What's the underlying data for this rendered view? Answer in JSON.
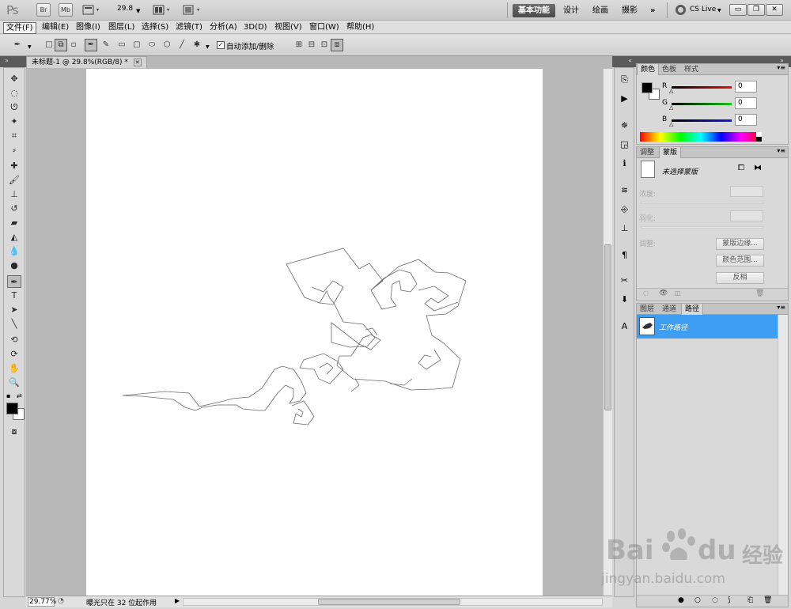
{
  "titlebar": {
    "logo": "Ps",
    "bridge_label": "Br",
    "minibridge_label": "Mb",
    "zoom": "29.8",
    "workspaces": [
      "基本功能",
      "设计",
      "绘画",
      "摄影"
    ],
    "more": "»",
    "cs_live": "CS Live"
  },
  "menu": [
    "文件(F)",
    "编辑(E)",
    "图像(I)",
    "图层(L)",
    "选择(S)",
    "滤镜(T)",
    "分析(A)",
    "3D(D)",
    "视图(V)",
    "窗口(W)",
    "帮助(H)"
  ],
  "options": {
    "auto_add_delete": "自动添加/删除",
    "auto_checked": "✓"
  },
  "document": {
    "tab_title": "未标题-1 @ 29.8%(RGB/8) *",
    "close": "✕"
  },
  "status": {
    "zoom": "29.77%",
    "message": "曝光只在 32 位起作用"
  },
  "color_panel": {
    "tabs": [
      "颜色",
      "色板",
      "样式"
    ],
    "channels": [
      {
        "label": "R",
        "value": "0",
        "color": "#d01010"
      },
      {
        "label": "G",
        "value": "0",
        "color": "#18b818"
      },
      {
        "label": "B",
        "value": "0",
        "color": "#1818d0"
      }
    ]
  },
  "mask_panel": {
    "tabs": [
      "调整",
      "蒙版"
    ],
    "no_mask": "未选择蒙版",
    "density_label": "浓度:",
    "feather_label": "羽化:",
    "adjust_label": "调整:",
    "mask_edge": "蒙版边缘...",
    "color_range": "颜色范围...",
    "invert": "反相"
  },
  "paths_panel": {
    "tabs": [
      "图层",
      "通道",
      "路径"
    ],
    "item": "工作路径"
  },
  "watermark": {
    "logo": "Bai",
    "logo_tail": "du",
    "cn": "经验",
    "url": "jingyan.baidu.com"
  },
  "colors": {
    "accent": "#3e9ef2",
    "canvas_bg": "#b8b8b8"
  }
}
